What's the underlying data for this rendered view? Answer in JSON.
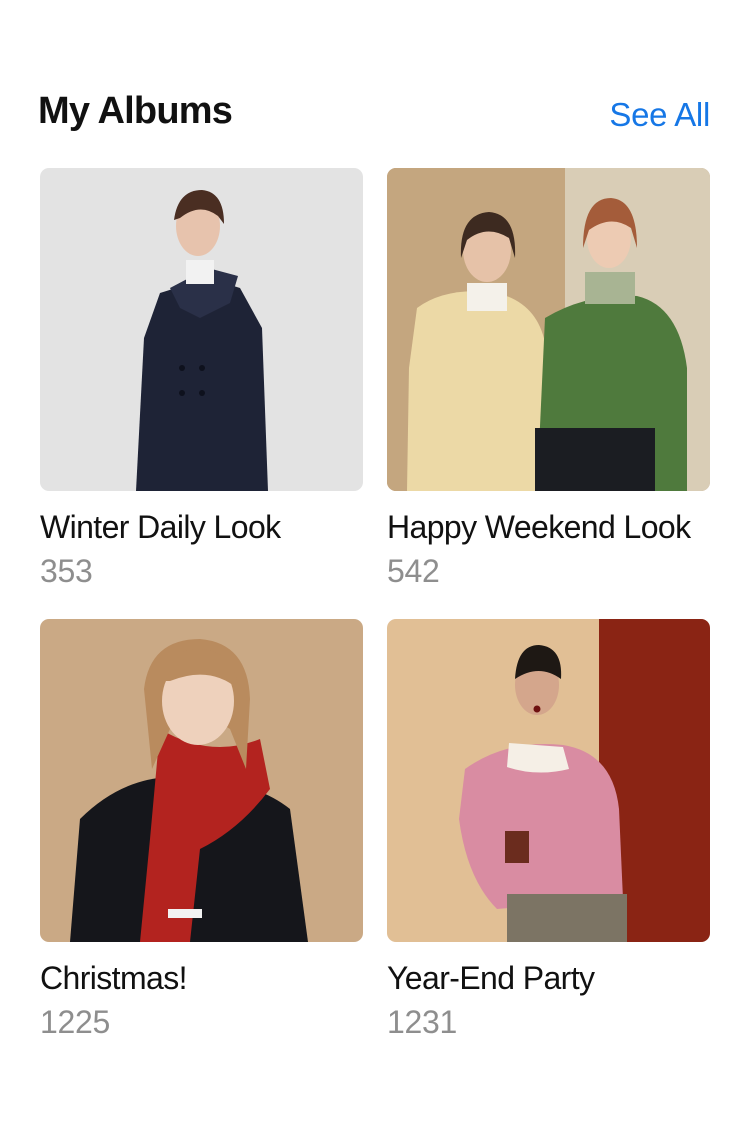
{
  "header": {
    "title": "My Albums",
    "see_all": "See All"
  },
  "colors": {
    "accent": "#1677e6",
    "count_text": "#8e8e8e"
  },
  "albums": [
    {
      "name": "Winter Daily Look",
      "count": "353"
    },
    {
      "name": "Happy Weekend Look",
      "count": "542"
    },
    {
      "name": "Christmas!",
      "count": "1225"
    },
    {
      "name": "Year-End Party",
      "count": "1231"
    }
  ]
}
